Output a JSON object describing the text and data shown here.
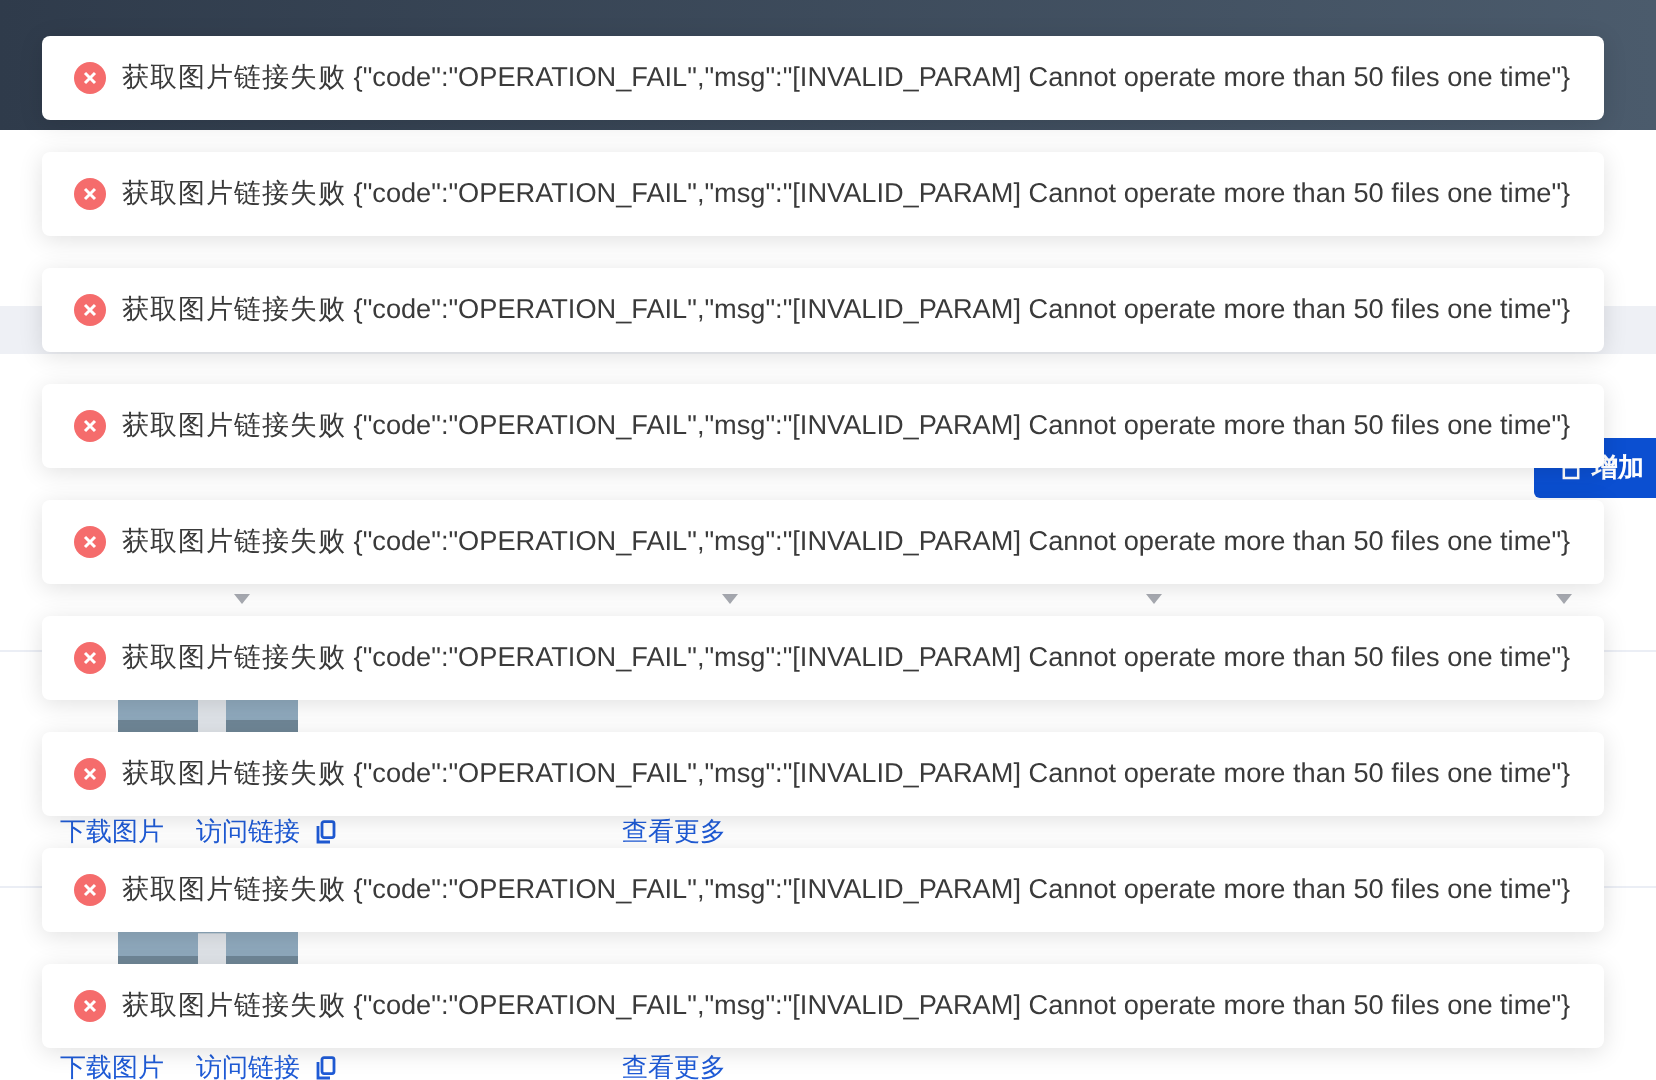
{
  "toolbar": {
    "add_button": "增加"
  },
  "table": {
    "rows": [
      {
        "kind": "picture",
        "actions": [
          "下载图片",
          "访问链接"
        ],
        "more": "查看更多"
      },
      {
        "kind": "picture",
        "actions": [
          "下载图片",
          "访问链接"
        ],
        "more": "查看更多"
      }
    ]
  },
  "toasts": [
    {
      "kind": "error",
      "text": "获取图片链接失败 {\"code\":\"OPERATION_FAIL\",\"msg\":\"[INVALID_PARAM] Cannot operate more than 50 files one time\"}"
    },
    {
      "kind": "error",
      "text": "获取图片链接失败 {\"code\":\"OPERATION_FAIL\",\"msg\":\"[INVALID_PARAM] Cannot operate more than 50 files one time\"}"
    },
    {
      "kind": "error",
      "text": "获取图片链接失败 {\"code\":\"OPERATION_FAIL\",\"msg\":\"[INVALID_PARAM] Cannot operate more than 50 files one time\"}"
    },
    {
      "kind": "error",
      "text": "获取图片链接失败 {\"code\":\"OPERATION_FAIL\",\"msg\":\"[INVALID_PARAM] Cannot operate more than 50 files one time\"}"
    },
    {
      "kind": "error",
      "text": "获取图片链接失败 {\"code\":\"OPERATION_FAIL\",\"msg\":\"[INVALID_PARAM] Cannot operate more than 50 files one time\"}"
    },
    {
      "kind": "error",
      "text": "获取图片链接失败 {\"code\":\"OPERATION_FAIL\",\"msg\":\"[INVALID_PARAM] Cannot operate more than 50 files one time\"}"
    },
    {
      "kind": "error",
      "text": "获取图片链接失败 {\"code\":\"OPERATION_FAIL\",\"msg\":\"[INVALID_PARAM] Cannot operate more than 50 files one time\"}"
    },
    {
      "kind": "error",
      "text": "获取图片链接失败 {\"code\":\"OPERATION_FAIL\",\"msg\":\"[INVALID_PARAM] Cannot operate more than 50 files one time\"}"
    },
    {
      "kind": "error",
      "text": "获取图片链接失败 {\"code\":\"OPERATION_FAIL\",\"msg\":\"[INVALID_PARAM] Cannot operate more than 50 files one time\"}"
    }
  ]
}
